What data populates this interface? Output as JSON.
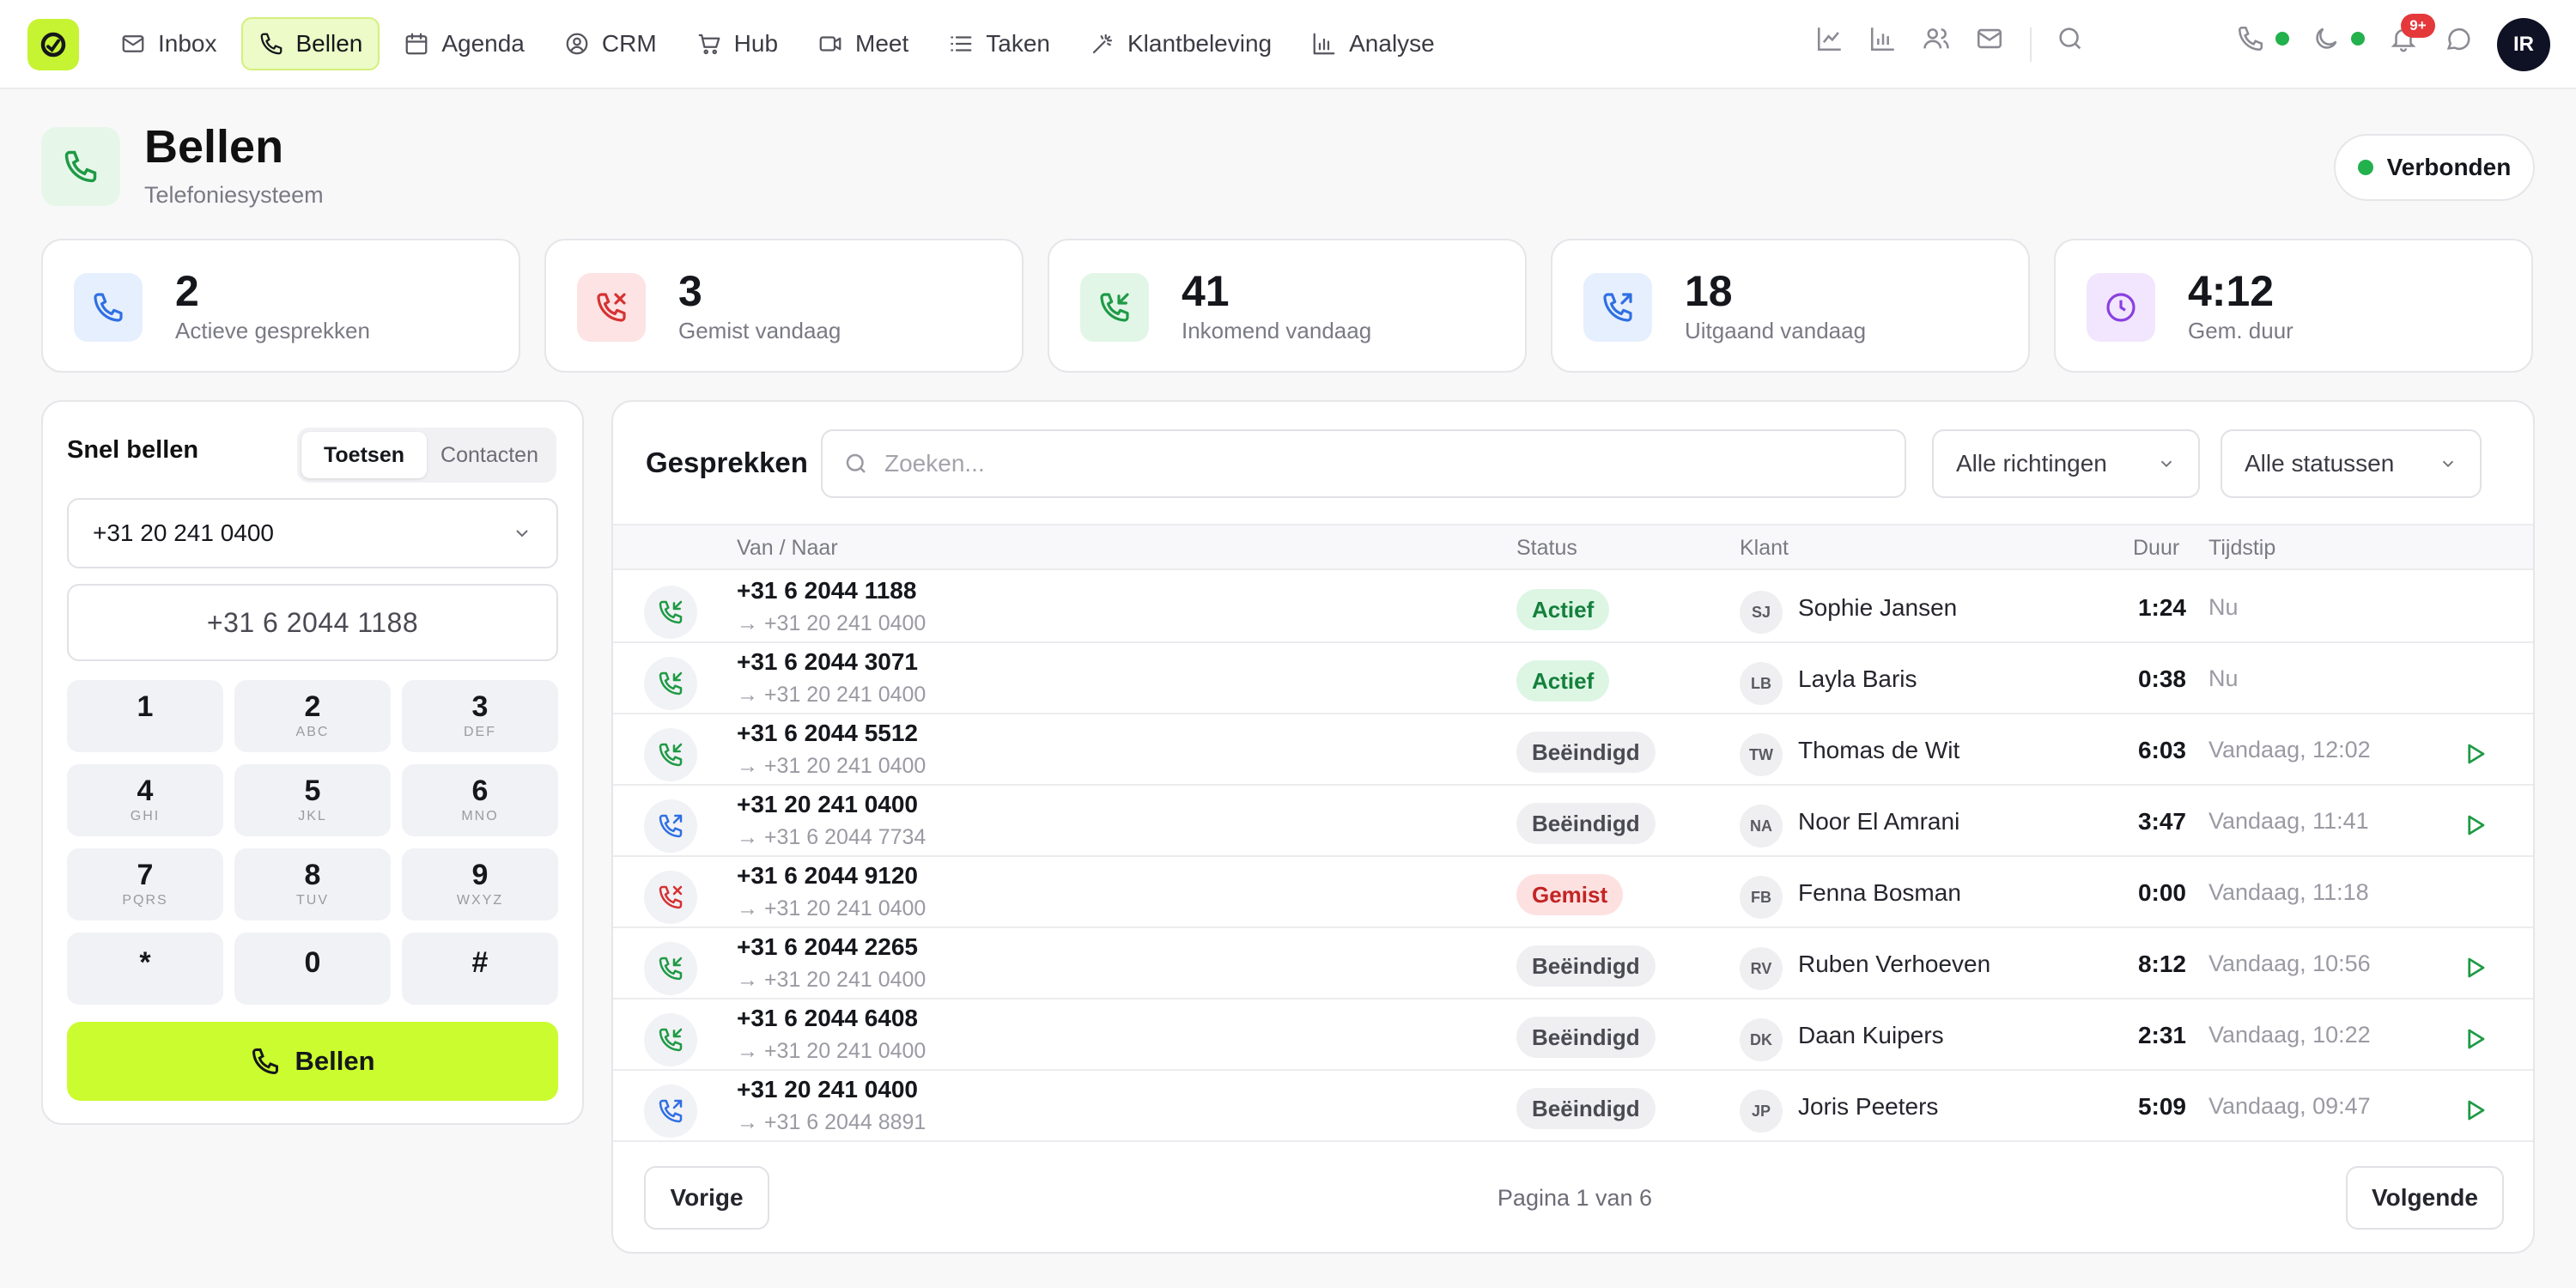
{
  "nav": {
    "items": [
      {
        "label": "Inbox",
        "icon": "mail-icon",
        "active": false
      },
      {
        "label": "Bellen",
        "icon": "phone-icon",
        "active": true
      },
      {
        "label": "Agenda",
        "icon": "calendar-icon",
        "active": false
      },
      {
        "label": "CRM",
        "icon": "user-circle-icon",
        "active": false
      },
      {
        "label": "Hub",
        "icon": "cart-icon",
        "active": false
      },
      {
        "label": "Meet",
        "icon": "video-icon",
        "active": false
      },
      {
        "label": "Taken",
        "icon": "list-icon",
        "active": false
      },
      {
        "label": "Klantbeleving",
        "icon": "sparkle-icon",
        "active": false
      },
      {
        "label": "Analyse",
        "icon": "bar-chart-icon",
        "active": false
      }
    ],
    "notification_badge": "9+",
    "user_initials": "IR"
  },
  "header": {
    "title": "Bellen",
    "subtitle": "Telefoniesysteem",
    "connection_status": "Verbonden"
  },
  "stats": [
    {
      "value": "2",
      "label": "Actieve gesprekken",
      "icon": "phone-icon",
      "color": "#2f6fe4",
      "bg": "#e6effd"
    },
    {
      "value": "3",
      "label": "Gemist vandaag",
      "icon": "phone-missed-icon",
      "color": "#d63232",
      "bg": "#fde3e3"
    },
    {
      "value": "41",
      "label": "Inkomend vandaag",
      "icon": "phone-incoming-icon",
      "color": "#1e9a45",
      "bg": "#e2f6e7"
    },
    {
      "value": "18",
      "label": "Uitgaand vandaag",
      "icon": "phone-outgoing-icon",
      "color": "#2f6fe4",
      "bg": "#e6effd"
    },
    {
      "value": "4:12",
      "label": "Gem. duur",
      "icon": "clock-icon",
      "color": "#8a3fe0",
      "bg": "#f1e6fd"
    }
  ],
  "dialer": {
    "title": "Snel bellen",
    "tabs": [
      "Toetsen",
      "Contacten"
    ],
    "active_tab": "Toetsen",
    "line": "+31 20 241 0400",
    "display": "+31 6 2044 1188",
    "keys": [
      {
        "digit": "1",
        "letters": ""
      },
      {
        "digit": "2",
        "letters": "ABC"
      },
      {
        "digit": "3",
        "letters": "DEF"
      },
      {
        "digit": "4",
        "letters": "GHI"
      },
      {
        "digit": "5",
        "letters": "JKL"
      },
      {
        "digit": "6",
        "letters": "MNO"
      },
      {
        "digit": "7",
        "letters": "PQRS"
      },
      {
        "digit": "8",
        "letters": "TUV"
      },
      {
        "digit": "9",
        "letters": "WXYZ"
      },
      {
        "digit": "*",
        "letters": ""
      },
      {
        "digit": "0",
        "letters": ""
      },
      {
        "digit": "#",
        "letters": ""
      }
    ],
    "call_label": "Bellen",
    "accent": "#cbfc2f"
  },
  "calls": {
    "title": "Gesprekken",
    "search_placeholder": "Zoeken...",
    "filter_direction": "Alle richtingen",
    "filter_status": "Alle statussen",
    "columns": {
      "number": "Van / Naar",
      "status": "Status",
      "client": "Klant",
      "duration": "Duur",
      "time": "Tijdstip"
    },
    "rows": [
      {
        "direction": "incoming",
        "number": "+31 6 2044 1188",
        "to": "+31 20 241 0400",
        "status": "Actief",
        "status_kind": "actief",
        "initials": "SJ",
        "client": "Sophie Jansen",
        "duration": "1:24",
        "time": "Nu",
        "has_recording": false
      },
      {
        "direction": "incoming",
        "number": "+31 6 2044 3071",
        "to": "+31 20 241 0400",
        "status": "Actief",
        "status_kind": "actief",
        "initials": "LB",
        "client": "Layla Baris",
        "duration": "0:38",
        "time": "Nu",
        "has_recording": false
      },
      {
        "direction": "incoming",
        "number": "+31 6 2044 5512",
        "to": "+31 20 241 0400",
        "status": "Beëindigd",
        "status_kind": "beeindigd",
        "initials": "TW",
        "client": "Thomas de Wit",
        "duration": "6:03",
        "time": "Vandaag, 12:02",
        "has_recording": true
      },
      {
        "direction": "outgoing",
        "number": "+31 20 241 0400",
        "to": "+31 6 2044 7734",
        "status": "Beëindigd",
        "status_kind": "beeindigd",
        "initials": "NA",
        "client": "Noor El Amrani",
        "duration": "3:47",
        "time": "Vandaag, 11:41",
        "has_recording": true
      },
      {
        "direction": "missed",
        "number": "+31 6 2044 9120",
        "to": "+31 20 241 0400",
        "status": "Gemist",
        "status_kind": "gemist",
        "initials": "FB",
        "client": "Fenna Bosman",
        "duration": "0:00",
        "time": "Vandaag, 11:18",
        "has_recording": false
      },
      {
        "direction": "incoming",
        "number": "+31 6 2044 2265",
        "to": "+31 20 241 0400",
        "status": "Beëindigd",
        "status_kind": "beeindigd",
        "initials": "RV",
        "client": "Ruben Verhoeven",
        "duration": "8:12",
        "time": "Vandaag, 10:56",
        "has_recording": true
      },
      {
        "direction": "incoming",
        "number": "+31 6 2044 6408",
        "to": "+31 20 241 0400",
        "status": "Beëindigd",
        "status_kind": "beeindigd",
        "initials": "DK",
        "client": "Daan Kuipers",
        "duration": "2:31",
        "time": "Vandaag, 10:22",
        "has_recording": true
      },
      {
        "direction": "outgoing",
        "number": "+31 20 241 0400",
        "to": "+31 6 2044 8891",
        "status": "Beëindigd",
        "status_kind": "beeindigd",
        "initials": "JP",
        "client": "Joris Peeters",
        "duration": "5:09",
        "time": "Vandaag, 09:47",
        "has_recording": true
      }
    ],
    "pagination": {
      "prev": "Vorige",
      "info": "Pagina 1 van 6",
      "next": "Volgende"
    }
  }
}
